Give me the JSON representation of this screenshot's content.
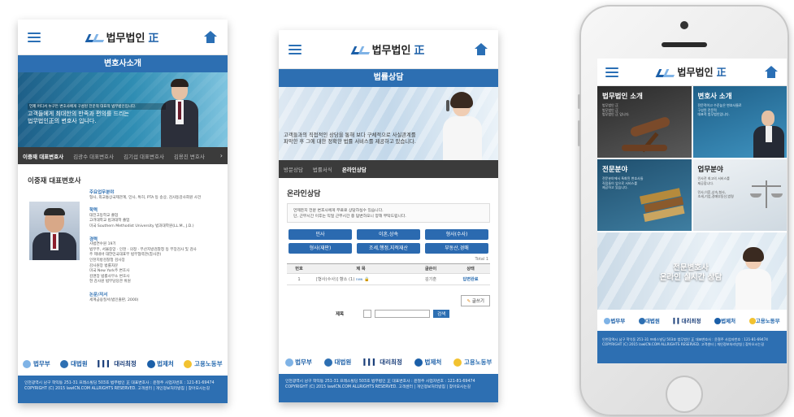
{
  "logo_text": "법무법인",
  "logo_highlight": "正",
  "s1": {
    "title": "변호사소개",
    "banner_small": "언제 어디서 누구든 변호사에게 구성된 전문적 대표적 법무법인입니다.",
    "banner_main": "고객들에게 최대한의 만족과 편의를 드리는\n법무법인正의 변호사 입니다.",
    "tabs": [
      "이중재 대표변호사",
      "김광수 대표변호사",
      "김기섭 대표변호사",
      "김용진 변호사"
    ],
    "lawyer_name": "이중재 대표변호사",
    "sec_practice": "주요업무분야",
    "practice_text": "형사, 외교통상국제관계, 민사, 특허, PTA 등 송상, 검사동감사회원 사건",
    "sec_edu": "학력",
    "edu": [
      "대전고등학교 졸업",
      "고려대학교 법과대학 졸업",
      "미국 Southern Methodist University 법과대학원(LL.M., J.D.)"
    ],
    "sec_career": "경력",
    "career": [
      "사법연수원 19기",
      "법무부, 서울중앙 · 인천 · 의정 · 부산지방검찰청 등 부장검사 및 검사",
      "주 제네바 대한민국대표부 법무협력관(참사관)",
      "인천지방검찰청 검사장",
      "감사원장 법률자문",
      "미국 New York주 변호사",
      "김앤장 법률사무소 변호사",
      "현 감사원 법무담당관 위원"
    ],
    "sec_paper": "논문/저서",
    "paper_text": "세계금융질서(법인출판, 2000)",
    "footer": "인천광역시 남구 학익동 251-31 프레스빌딩 503호 법무법인 正 대표변호사 : 윤철주 사업자번호 : 121-81-69474\nCOPYRIGHT (C) 2015 lawICN.COM ALLRIGHTS RESERVED. 고객센터 | 개인정보처리방침 | 찾아오시는길"
  },
  "s2": {
    "title": "법률상담",
    "banner_text": "고객들과의 직접적인 상담을 통해 보다 구체적으로 사실관계를\n파악한 후 그에 대한 정확한 법률 서비스를 제공하고 있습니다.",
    "tabs": [
      "방문상담",
      "법률서식",
      "온라인상담"
    ],
    "section_title": "온라인상담",
    "notice": "언제든지 전문 변호사에게 무료로 상담하실수 있습니다.\n단, 근무시간 이후는 익일 근무시간 중 답변하오니 양해 부탁드립니다.",
    "cats": [
      "민사",
      "이혼,상속",
      "형사(수사)",
      "형사(재판)",
      "조세,행정,지적재산",
      "부동산,경매"
    ],
    "total": "Total 1",
    "th": [
      "번호",
      "제 목",
      "글쓴이",
      "상태"
    ],
    "row": {
      "no": "1",
      "title": "[형사(수사)] 향소 (1)",
      "writer": "김기훈",
      "status": "답변완료"
    },
    "write_btn": "글쓰기",
    "search_label": "제목",
    "search_select": "",
    "search_btn": "검색",
    "footer": "인천광역시 남구 학익동 251-31 프레스빌딩 503호 법무법인 正 대표변호사 : 윤철주 사업자번호 : 121-81-69474\nCOPYRIGHT (C) 2015 lawICN.COM ALLRIGHTS RESERVED. 고객센터 | 개인정보처리방침 | 찾아오시는길"
  },
  "s3": {
    "tiles": [
      {
        "title": "법무법인 소개",
        "desc": "법무법인 正\n법무법인 正\n법무법인 正 입니다."
      },
      {
        "title": "변호사 소개",
        "desc": "전문적이고 수준높은 변호사들로\n구성된 전문적\n대표적 법무법인입니다."
      },
      {
        "title": "전문분야",
        "desc": "전문분야에서 특화된 변호사들\n직접들이 앞으로 서비스를\n제공하고 있습니다."
      },
      {
        "title": "업무분야",
        "desc": "민사전 최고의 서비스를\n제공합니다.\n\n민사,이혼,상속,형사,\n조세,기업,경매부동산,법령"
      }
    ],
    "promo": "전문변호사\n온라인 실시간 상담",
    "footer": "인천광역시 남구 학익동 251-31 프레스빌딩 503호 법무법인 正 대표변호사 : 윤철주 사업자번호 : 121-81-69474\nCOPYRIGHT (C) 2015 lawICN.COM ALLRIGHTS RESERVED. 고객센터 | 개인정보처리방침 | 찾아오시는길"
  },
  "partners": [
    "법무부",
    "대법원",
    "대리최정",
    "법제처",
    "고용노동부"
  ],
  "colors": {
    "brand": "#2d6fb2",
    "dark_tab": "#3b3b3b",
    "gold": "#f2c230"
  }
}
